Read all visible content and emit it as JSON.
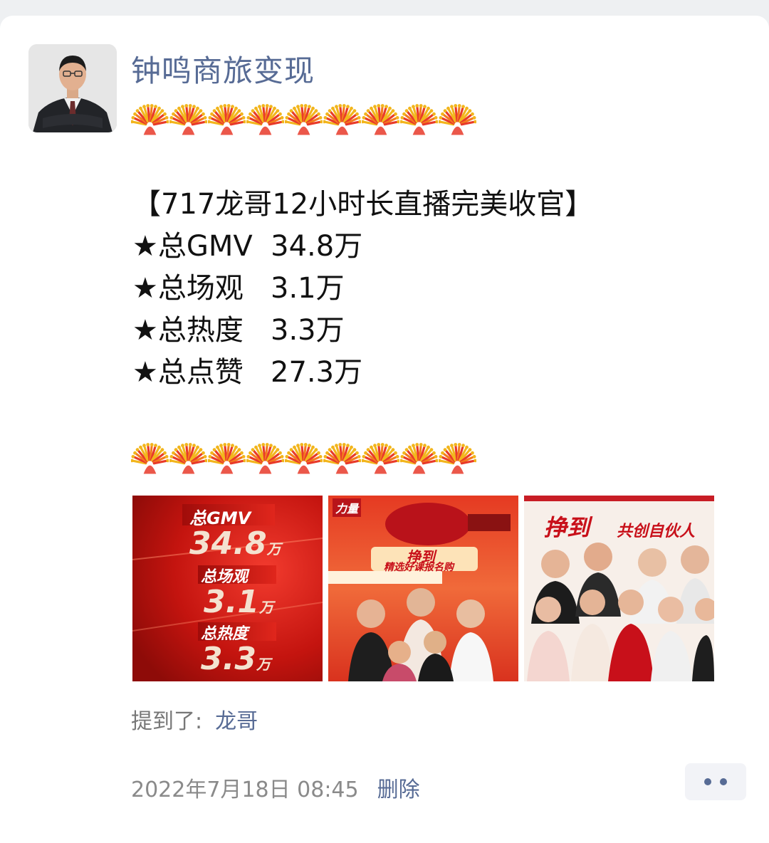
{
  "post": {
    "author": "钟鸣商旅变现",
    "firework_icon": "fireworks-emoji",
    "firework_count": 9,
    "lines": [
      "【717龙哥12小时长直播完美收官】",
      "★总GMV  34.8万",
      "★总场观   3.1万",
      "★总热度   3.3万",
      "★总点赞   27.3万"
    ]
  },
  "images": {
    "img1": {
      "rows": [
        {
          "label": "总GMV",
          "value": "34.8",
          "unit": "万"
        },
        {
          "label": "总场观",
          "value": "3.1",
          "unit": "万"
        },
        {
          "label": "总热度",
          "value": "3.3",
          "unit": "万"
        }
      ]
    },
    "img2": {
      "headline": "挣到",
      "subline": "精选好课报名购",
      "badge": "力量"
    },
    "img3": {
      "headline": "挣到",
      "subline": "共创自伙人"
    }
  },
  "mention": {
    "label": "提到了:",
    "name": "龙哥"
  },
  "footer": {
    "timestamp": "2022年7月18日 08:45",
    "delete_label": "删除"
  },
  "colors": {
    "link": "#576b95",
    "red": "#d81e1e"
  }
}
